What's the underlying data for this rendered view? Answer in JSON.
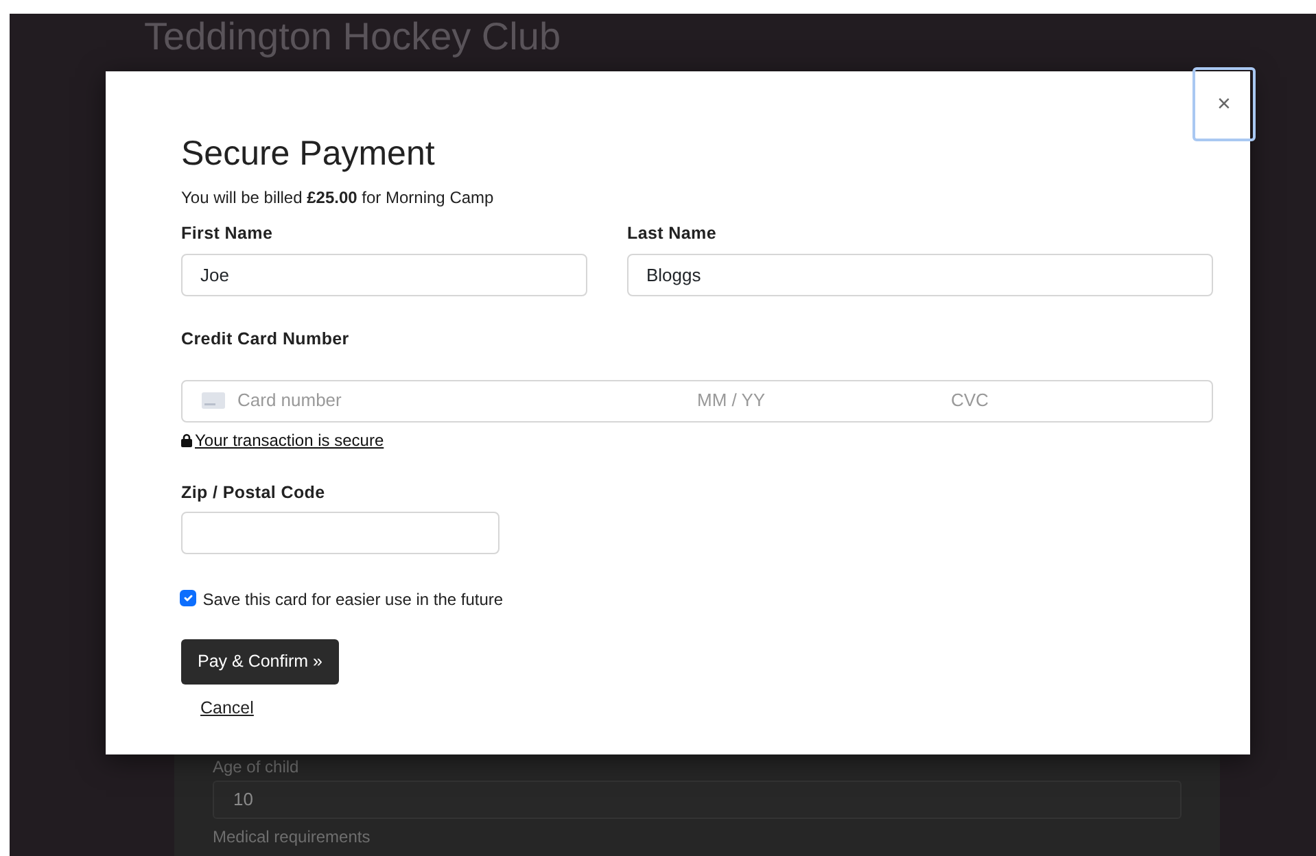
{
  "background_page": {
    "title": "Teddington Hockey Club",
    "fields": [
      {
        "label": "Age of child",
        "value": "10"
      },
      {
        "label": "Medical requirements"
      }
    ]
  },
  "modal": {
    "close": "×",
    "title": "Secure Payment",
    "billing": "You will be billed **£25.00** for Morning Camp",
    "first_name": {
      "label": "First Name",
      "value": "Joe"
    },
    "last_name": {
      "label": "Last Name",
      "value": "Bloggs"
    },
    "card": {
      "label": "Credit Card Number",
      "placeholder": "Card number",
      "expiry_placeholder": "MM / YY",
      "cvc_placeholder": "CVC"
    },
    "secure_note": "Your transaction is secure",
    "zip": {
      "label": "Zip / Postal Code"
    },
    "save_card": {
      "label": "Save this card for easier use in the future",
      "checked": true
    },
    "submit": "Pay & Confirm »",
    "cancel": "Cancel"
  }
}
